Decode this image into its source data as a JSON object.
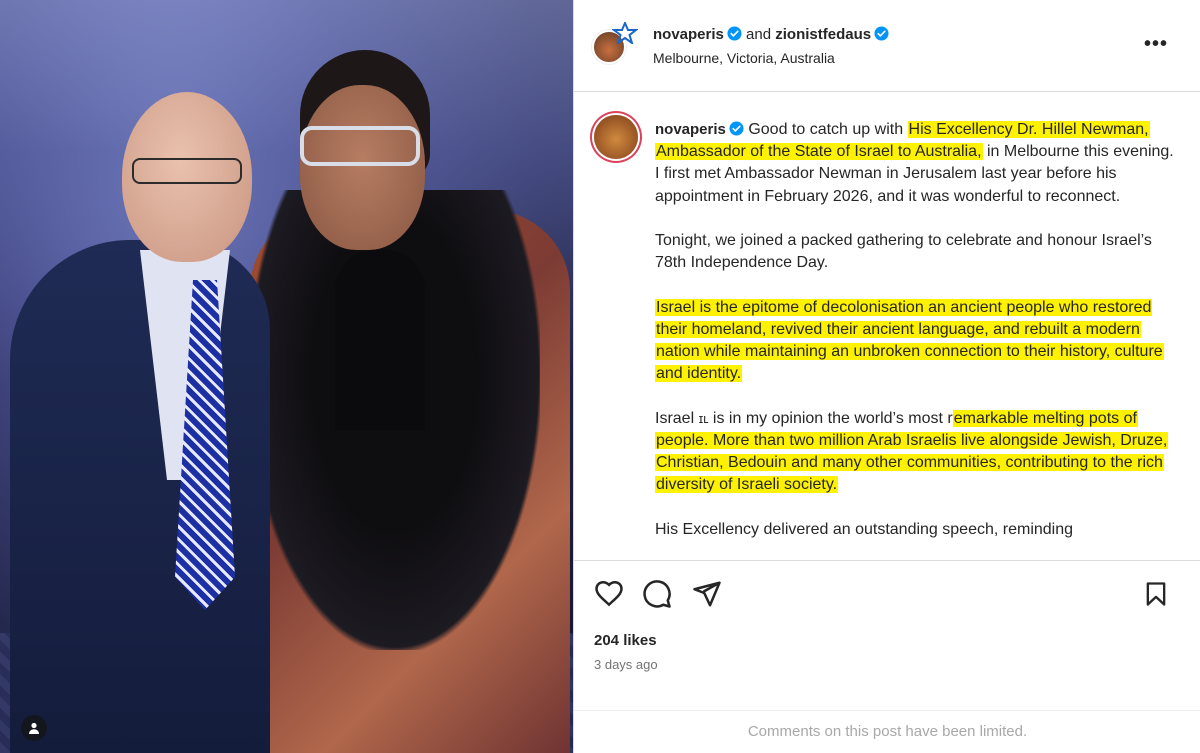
{
  "header": {
    "user1": "novaperis",
    "and_text": "and",
    "user2": "zionistfedaus",
    "location": "Melbourne, Victoria, Australia",
    "more_label": "•••"
  },
  "caption": {
    "author": "novaperis",
    "p1_a": "Good to catch up with ",
    "p1_hl": "His Excellency Dr. Hillel Newman, Ambassador of the State of Israel to Australia,",
    "p1_b": " in Melbourne this evening. I first met Ambassador Newman in Jerusalem last year before his appointment in February 2026, and it was wonderful to reconnect.",
    "p2": "Tonight, we joined a packed gathering to celebrate and honour Israel’s 78th Independence Day.",
    "p3_hl": "Israel is the epitome of decolonisation an ancient people who restored their homeland, revived their ancient language, and rebuilt a modern nation while maintaining an unbroken connection to their history, culture and identity.",
    "p4_a": "Israel ",
    "p4_flag": "ɪʟ",
    "p4_b": " is in my opinion the world’s most r",
    "p4_hl": "emarkable melting pots of people. More than two million Arab Israelis live alongside Jewish, Druze, Christian, Bedouin and many other communities, contributing to the rich diversity of Israeli society.",
    "p5": "His Excellency delivered an outstanding speech, reminding"
  },
  "stats": {
    "likes": "204 likes",
    "time_ago": "3 days ago"
  },
  "footer": {
    "comments_limited": "Comments on this post have been limited."
  },
  "colors": {
    "highlight": "#fff200",
    "verified": "#0095f6",
    "muted": "#737373"
  },
  "icons": [
    "user-tag-icon",
    "verified-icon",
    "more-options-icon",
    "heart-icon",
    "comment-icon",
    "share-icon",
    "save-bookmark-icon"
  ]
}
